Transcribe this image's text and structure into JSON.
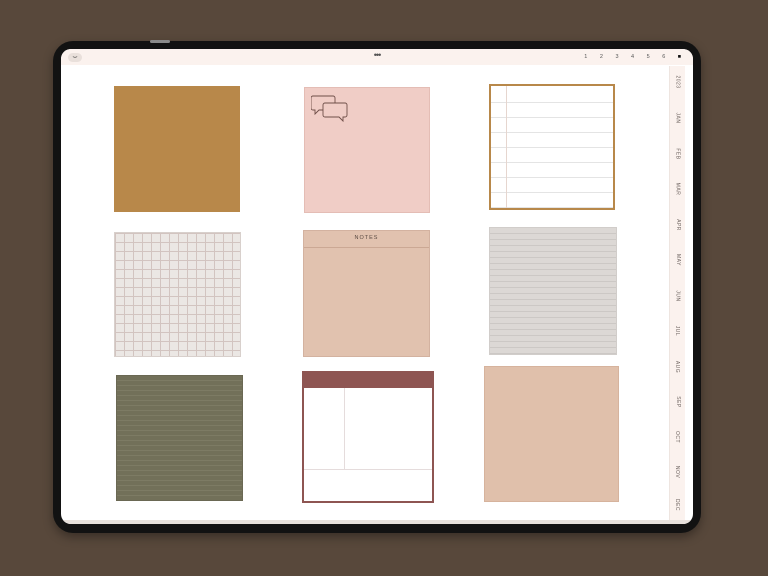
{
  "statusbar": {
    "home_icon_glyph": "⌣",
    "menu_dots": "•••",
    "page_tabs": [
      "1",
      "2",
      "3",
      "4",
      "5",
      "6"
    ],
    "active_tab_glyph": "■"
  },
  "month_rail": {
    "year": "2023",
    "months": [
      "JAN",
      "FEB",
      "MAR",
      "APR",
      "MAY",
      "JUN",
      "JUL",
      "AUG",
      "SEP",
      "OCT",
      "NOV",
      "DEC"
    ]
  },
  "notes": {
    "notes_title": "NOTES"
  },
  "colors": {
    "background": "#58483b",
    "mustard": "#b8884a",
    "blush": "#f0cdc6",
    "sand": "#e1c2af",
    "olive": "#727059",
    "burgundy": "#8e5552",
    "gray": "#dcd8d5"
  },
  "icons": {
    "home": "home-icon",
    "menu": "more-dots-icon",
    "speech": "speech-bubbles-icon"
  }
}
